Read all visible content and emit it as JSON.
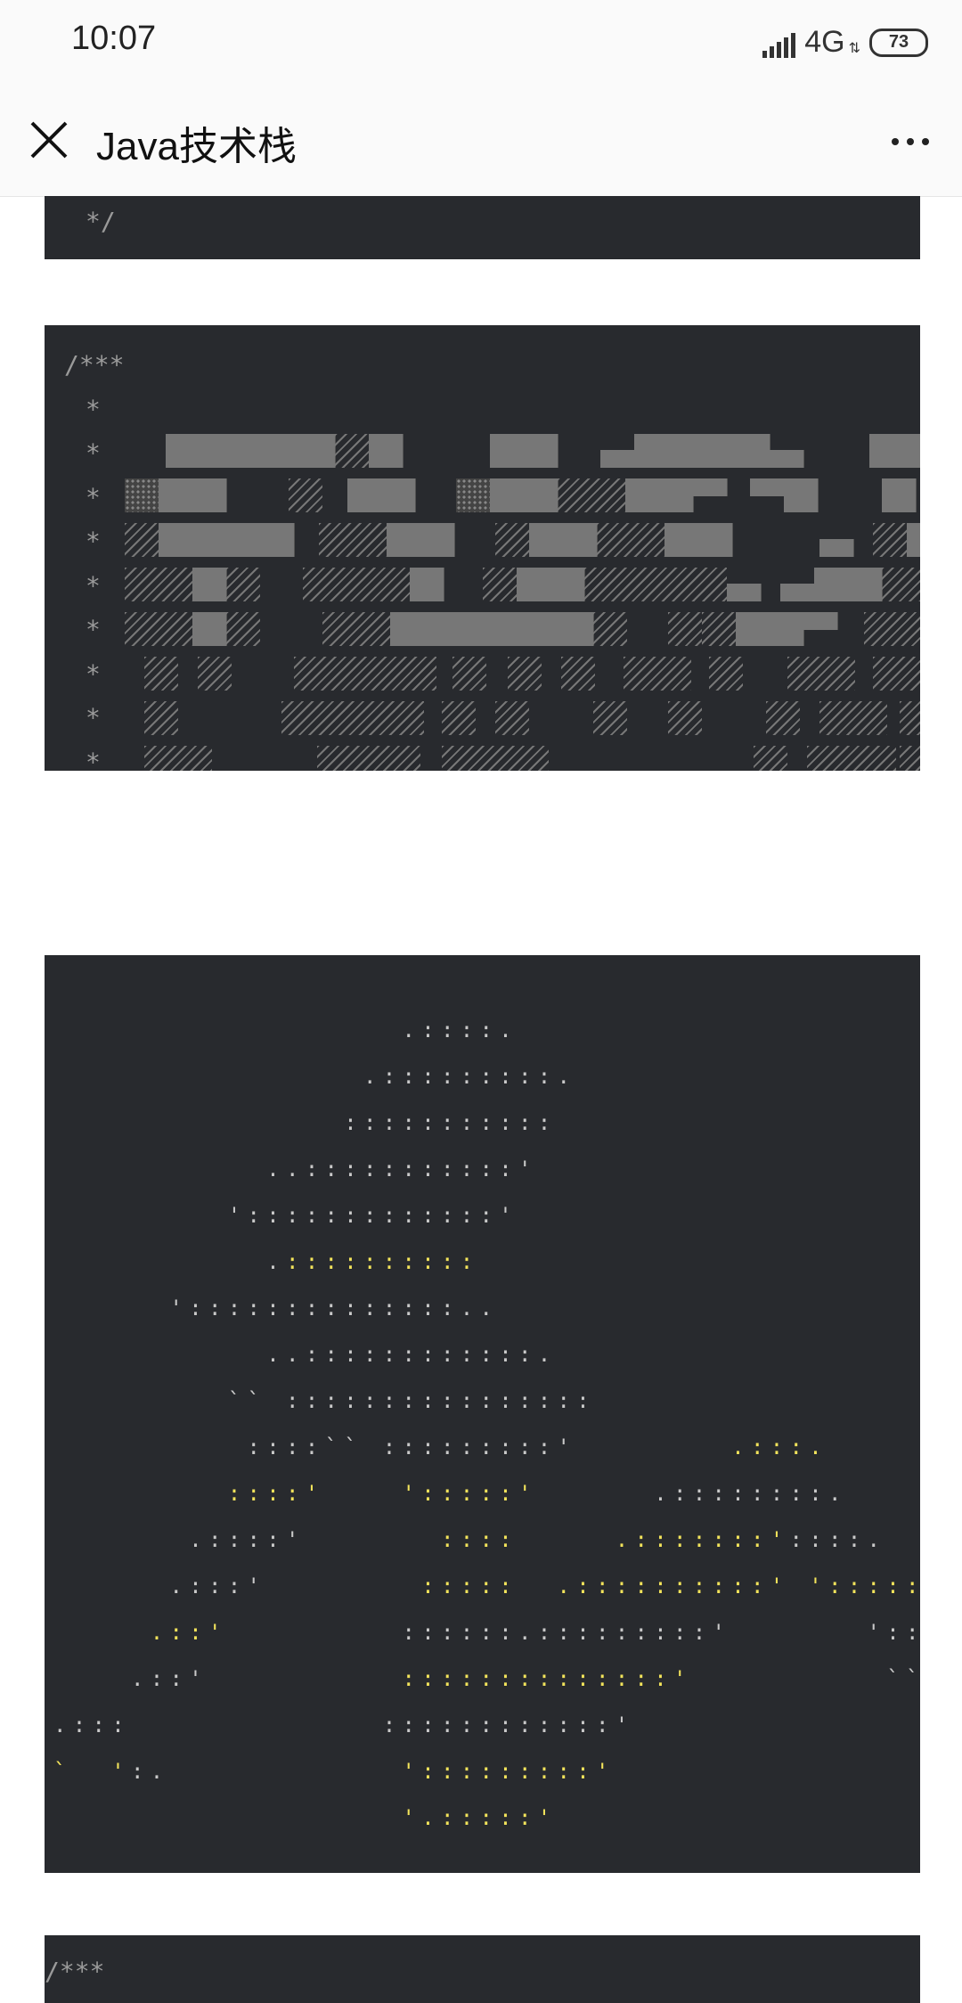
{
  "status_bar": {
    "time": "10:07",
    "network": "4G",
    "battery": "73"
  },
  "nav": {
    "title": "Java技术栈",
    "close_icon": "close-icon",
    "more_icon": "more-icon"
  },
  "blocks": {
    "first": {
      "line": "*/"
    },
    "second": {
      "open": "/***",
      "stars": [
        "*",
        "*",
        "*",
        "*",
        "*",
        "*",
        "*",
        "*",
        "*",
        "*"
      ],
      "close": "*/"
    },
    "ascii_art": {
      "lines": [
        [
          {
            "t": "                  .::::.",
            "c": "w"
          }
        ],
        [
          {
            "t": "                .:::::::::.",
            "c": "w"
          }
        ],
        [
          {
            "t": "               :::::::::::",
            "c": "w"
          }
        ],
        [
          {
            "t": "           ..:::::::::::'",
            "c": "w"
          }
        ],
        [
          {
            "t": "         ':::::::::::::'",
            "c": "w"
          }
        ],
        [
          {
            "t": "           .",
            "c": "w"
          },
          {
            "t": "::::::::::",
            "c": "y"
          }
        ],
        [
          {
            "t": "      '::::::::::::::..",
            "c": "w"
          }
        ],
        [
          {
            "t": "           ..::::::::::::.",
            "c": "w"
          }
        ],
        [
          {
            "t": "         `` ::::::::::::::::",
            "c": "w"
          }
        ],
        [
          {
            "t": "          ::::`` :::::::::'",
            "c": "w"
          },
          {
            "t": "        .:::.",
            "c": "y"
          }
        ],
        [
          {
            "t": "         ::::'",
            "c": "y"
          },
          {
            "t": "    ",
            "c": "w"
          },
          {
            "t": "':::::'",
            "c": "y"
          },
          {
            "t": "      .::::::::.",
            "c": "w"
          }
        ],
        [
          {
            "t": "       .::::'       ",
            "c": "w"
          },
          {
            "t": "::::",
            "c": "y"
          },
          {
            "t": "     ",
            "c": "w"
          },
          {
            "t": ".:::::::'",
            "c": "y"
          },
          {
            "t": "::::.",
            "c": "w"
          }
        ],
        [
          {
            "t": "      .:::'        ",
            "c": "w"
          },
          {
            "t": ":::::",
            "c": "y"
          },
          {
            "t": "  ",
            "c": "w"
          },
          {
            "t": ".::::::::::'",
            "c": "y"
          },
          {
            "t": " ",
            "c": "w"
          },
          {
            "t": "'::::::.",
            "c": "y"
          }
        ],
        [
          {
            "t": "     ",
            "c": "w"
          },
          {
            "t": ".::'",
            "c": "y"
          },
          {
            "t": "         ::::::.:::::::::'",
            "c": "w"
          },
          {
            "t": "       ':::",
            "c": "w"
          }
        ],
        [
          {
            "t": "    .::'          ",
            "c": "w"
          },
          {
            "t": "::::::::::::::'",
            "c": "y"
          },
          {
            "t": "          ``:",
            "c": "w"
          }
        ],
        [
          {
            "t": ".:::             ::::::::::::'",
            "c": "w"
          }
        ],
        [
          {
            "t": "`  ",
            "c": "y"
          },
          {
            "t": "'",
            "c": "y"
          },
          {
            "t": ":.",
            "c": "w"
          },
          {
            "t": "            ",
            "c": "w"
          },
          {
            "t": "':::::::::'",
            "c": "y"
          }
        ],
        [
          {
            "t": "                  ",
            "c": "w"
          },
          {
            "t": "'.:::::'",
            "c": "y"
          }
        ]
      ]
    },
    "fourth": {
      "open": "/***"
    }
  }
}
